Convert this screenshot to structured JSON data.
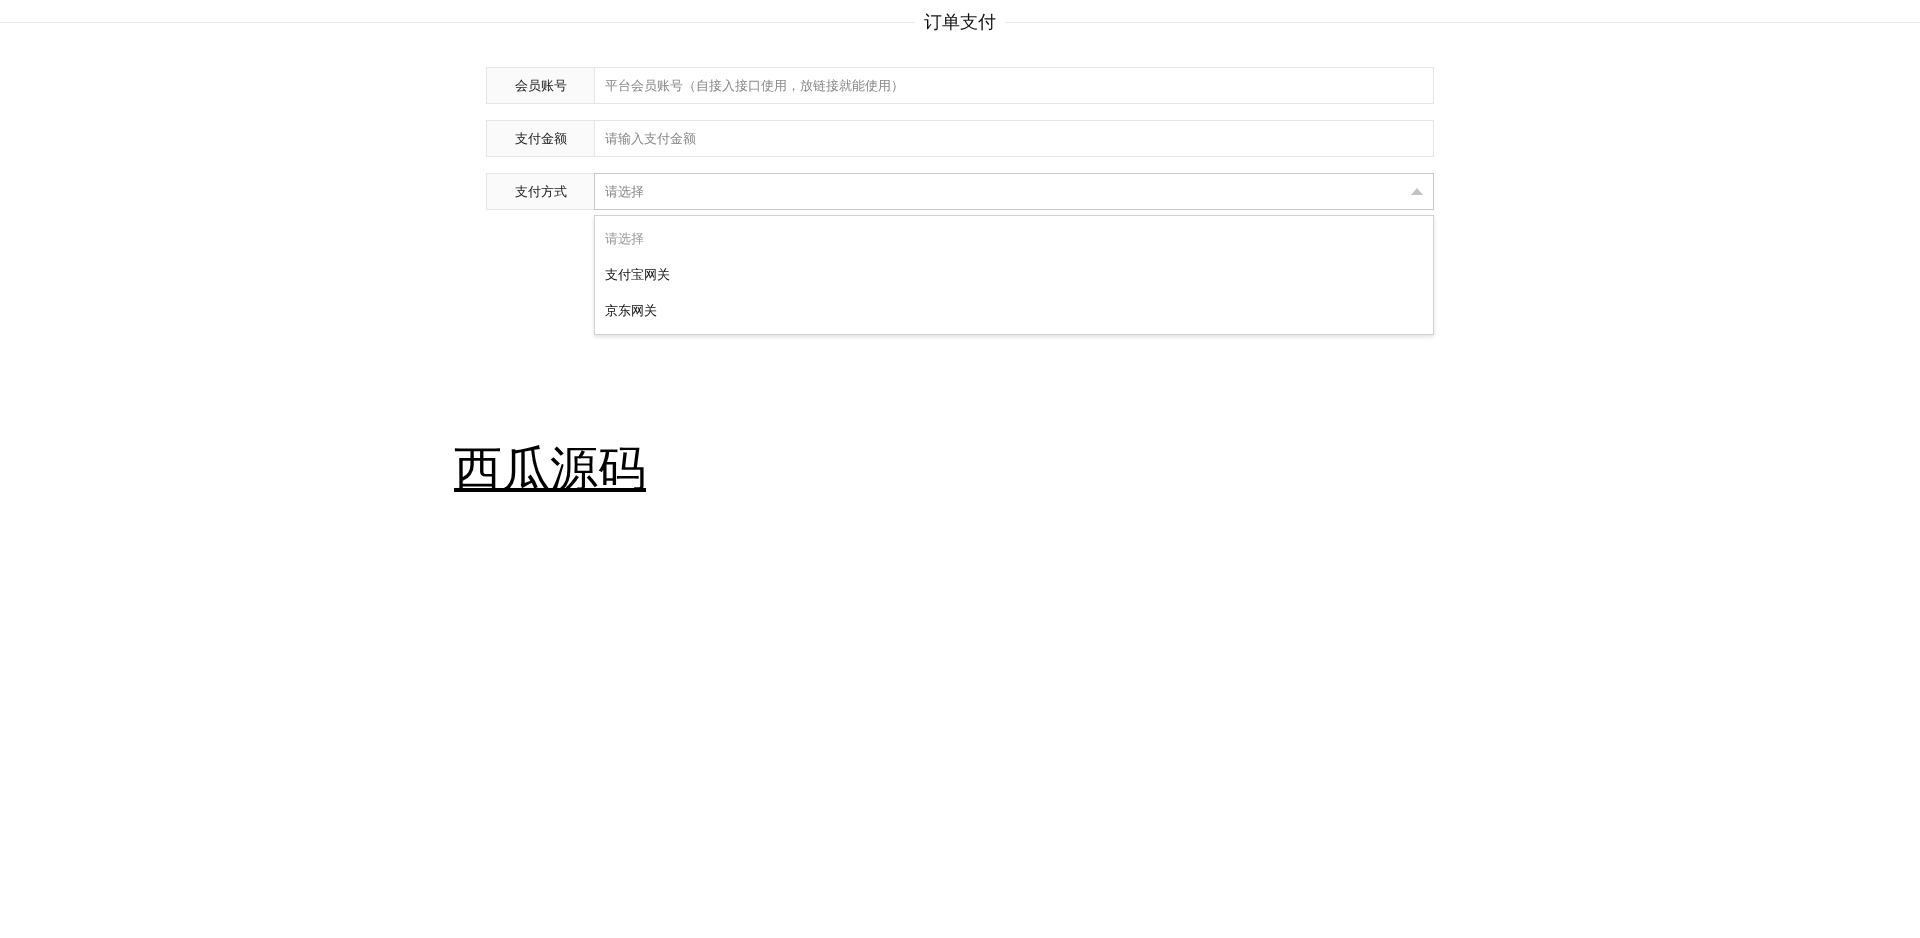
{
  "title": "订单支付",
  "fields": [
    {
      "label": "会员账号",
      "kind": "input",
      "placeholder": "平台会员账号（自接入接口使用，放链接就能使用）"
    },
    {
      "label": "支付金额",
      "kind": "input",
      "placeholder": "请输入支付金额"
    },
    {
      "label": "支付方式",
      "kind": "select",
      "placeholder": "请选择",
      "expanded": true,
      "options": [
        {
          "label": "请选择",
          "kind": "placeholder",
          "selected": false
        },
        {
          "label": "支付宝网关",
          "kind": "option",
          "selected": false
        },
        {
          "label": "京东网关",
          "kind": "option",
          "selected": false
        }
      ]
    }
  ],
  "link": "西瓜源码"
}
